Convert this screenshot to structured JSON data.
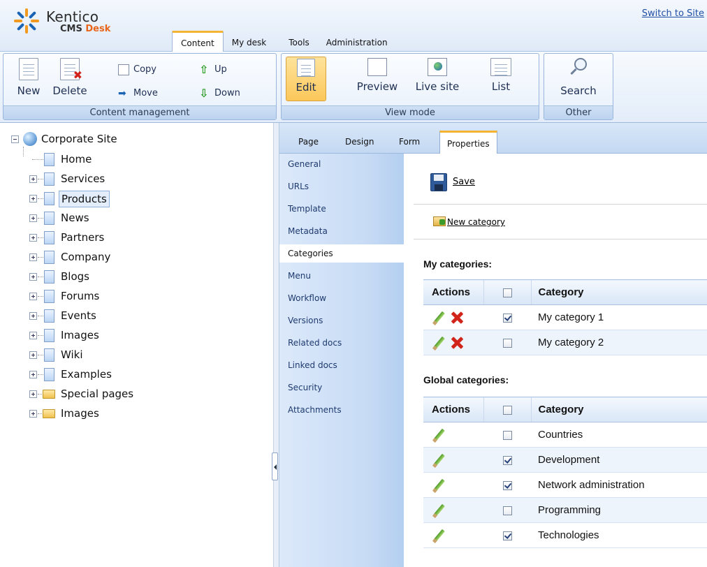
{
  "header": {
    "brand": "Kentico",
    "product_prefix": "CMS ",
    "product_accent": "Desk",
    "switch_link": "Switch to Site"
  },
  "main_tabs": [
    {
      "label": "Content",
      "active": true
    },
    {
      "label": "My desk",
      "active": false
    },
    {
      "label": "Tools",
      "active": false
    },
    {
      "label": "Administration",
      "active": false
    }
  ],
  "ribbon": {
    "content_management": {
      "caption": "Content management",
      "new": "New",
      "delete": "Delete",
      "copy": "Copy",
      "move": "Move",
      "up": "Up",
      "down": "Down"
    },
    "view_mode": {
      "caption": "View mode",
      "edit": "Edit",
      "preview": "Preview",
      "live_site": "Live site",
      "list": "List",
      "selected": "Edit"
    },
    "other": {
      "caption": "Other",
      "search": "Search"
    }
  },
  "tree": {
    "root": "Corporate Site",
    "nodes": [
      {
        "label": "Home",
        "type": "page",
        "expandable": false
      },
      {
        "label": "Services",
        "type": "page",
        "expandable": true
      },
      {
        "label": "Products",
        "type": "page",
        "expandable": true,
        "selected": true
      },
      {
        "label": "News",
        "type": "page",
        "expandable": true
      },
      {
        "label": "Partners",
        "type": "page",
        "expandable": true
      },
      {
        "label": "Company",
        "type": "page",
        "expandable": true
      },
      {
        "label": "Blogs",
        "type": "page",
        "expandable": true
      },
      {
        "label": "Forums",
        "type": "page",
        "expandable": true
      },
      {
        "label": "Events",
        "type": "page",
        "expandable": true
      },
      {
        "label": "Images",
        "type": "page",
        "expandable": true
      },
      {
        "label": "Wiki",
        "type": "page",
        "expandable": true
      },
      {
        "label": "Examples",
        "type": "page",
        "expandable": true
      },
      {
        "label": "Special pages",
        "type": "folder",
        "expandable": true
      },
      {
        "label": "Images",
        "type": "folder",
        "expandable": true
      }
    ]
  },
  "sub_tabs": [
    {
      "label": "Page",
      "active": false
    },
    {
      "label": "Design",
      "active": false
    },
    {
      "label": "Form",
      "active": false
    },
    {
      "label": "Properties",
      "active": true
    }
  ],
  "left_nav": [
    {
      "label": "General",
      "active": false
    },
    {
      "label": "URLs",
      "active": false
    },
    {
      "label": "Template",
      "active": false
    },
    {
      "label": "Metadata",
      "active": false
    },
    {
      "label": "Categories",
      "active": true
    },
    {
      "label": "Menu",
      "active": false
    },
    {
      "label": "Workflow",
      "active": false
    },
    {
      "label": "Versions",
      "active": false
    },
    {
      "label": "Related docs",
      "active": false
    },
    {
      "label": "Linked docs",
      "active": false
    },
    {
      "label": "Security",
      "active": false
    },
    {
      "label": "Attachments",
      "active": false
    }
  ],
  "content": {
    "save": "Save",
    "new_category": "New category",
    "my_categories": {
      "title": "My categories:",
      "headers": {
        "actions": "Actions",
        "category": "Category"
      },
      "rows": [
        {
          "name": "My category 1",
          "checked": true,
          "deletable": true
        },
        {
          "name": "My category 2",
          "checked": false,
          "deletable": true
        }
      ]
    },
    "global_categories": {
      "title": "Global categories:",
      "headers": {
        "actions": "Actions",
        "category": "Category"
      },
      "rows": [
        {
          "name": "Countries",
          "checked": false
        },
        {
          "name": "Development",
          "checked": true
        },
        {
          "name": "Network administration",
          "checked": true
        },
        {
          "name": "Programming",
          "checked": false
        },
        {
          "name": "Technologies",
          "checked": true
        }
      ]
    }
  },
  "colors": {
    "accent": "#f5b532",
    "brand_orange": "#e8661c",
    "link": "#1f4ea3",
    "delete_red": "#d1241b",
    "edit_green": "#4f9a2b"
  }
}
